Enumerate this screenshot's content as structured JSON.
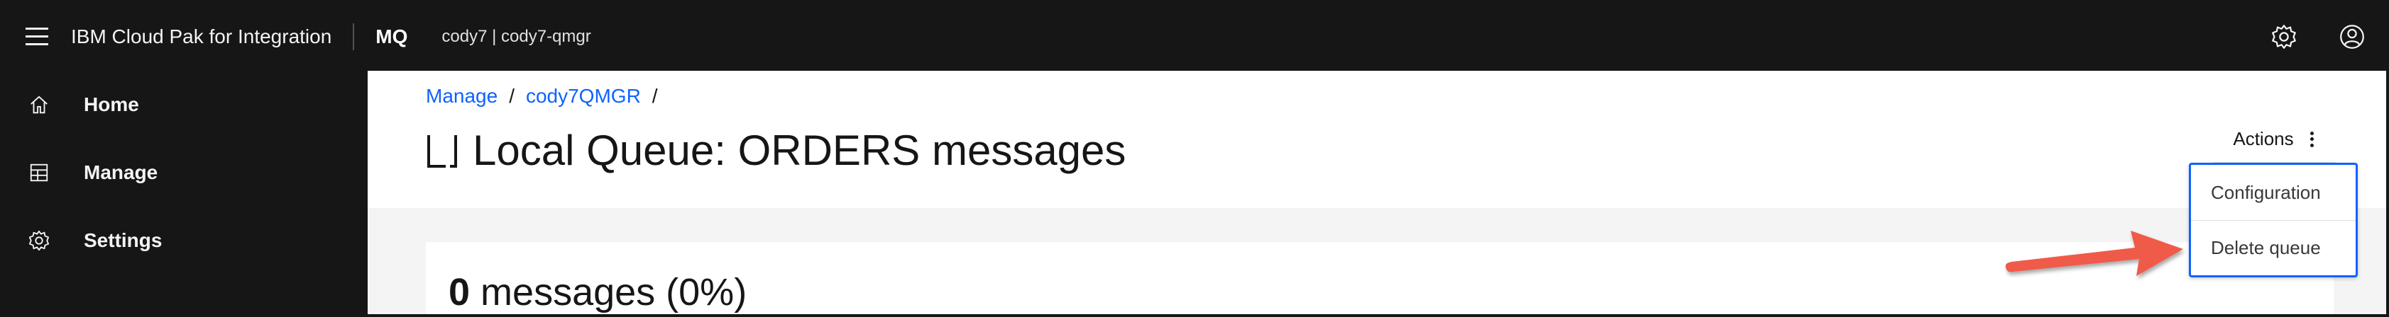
{
  "header": {
    "brand": "IBM Cloud Pak for Integration",
    "app_name": "MQ",
    "instance": "cody7 | cody7-qmgr"
  },
  "sidebar": {
    "items": [
      {
        "label": "Home",
        "icon": "home-icon"
      },
      {
        "label": "Manage",
        "icon": "table-icon"
      },
      {
        "label": "Settings",
        "icon": "gear-icon"
      }
    ]
  },
  "breadcrumb": {
    "items": [
      "Manage",
      "cody7QMGR"
    ],
    "separator": "/"
  },
  "page": {
    "title": "Local Queue: ORDERS messages"
  },
  "summary": {
    "count": "0",
    "text": " messages (0%)"
  },
  "actions": {
    "label": "Actions",
    "menu": [
      "Configuration",
      "Delete queue"
    ]
  },
  "colors": {
    "header_bg": "#161616",
    "link": "#0f62fe",
    "arrow": "#f05a4a"
  }
}
